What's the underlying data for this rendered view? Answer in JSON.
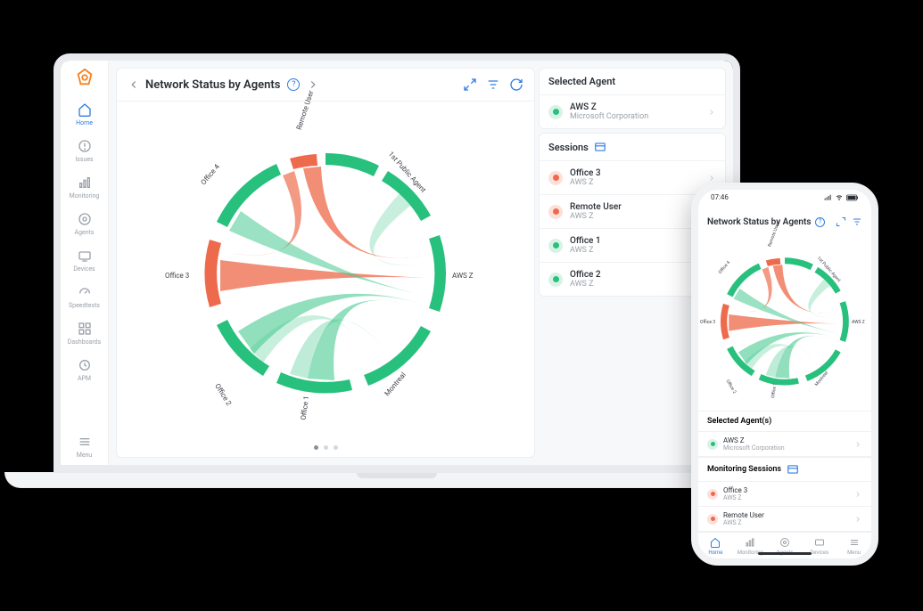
{
  "sidebar": {
    "items": [
      {
        "label": "Home",
        "icon": "home-icon",
        "active": true
      },
      {
        "label": "Issues",
        "icon": "issues-icon"
      },
      {
        "label": "Monitoring",
        "icon": "monitoring-icon"
      },
      {
        "label": "Agents",
        "icon": "agents-icon"
      },
      {
        "label": "Devices",
        "icon": "devices-icon"
      },
      {
        "label": "Speedtests",
        "icon": "speedtests-icon"
      },
      {
        "label": "Dashboards",
        "icon": "dashboards-icon"
      },
      {
        "label": "APM",
        "icon": "apm-icon"
      }
    ],
    "menu_label": "Menu"
  },
  "chart": {
    "title": "Network Status by Agents",
    "info_badge": "?",
    "nodes": [
      "Remote User",
      "1st Public Agent",
      "AWS Z",
      "Montreal",
      "Office 1",
      "Office 2",
      "Office 3",
      "Office 4"
    ]
  },
  "sidepanel": {
    "selected_header": "Selected Agent",
    "selected": {
      "name": "AWS Z",
      "sub": "Microsoft Corporation",
      "status": "green"
    },
    "sessions_header": "Sessions",
    "sessions": [
      {
        "name": "Office 3",
        "sub": "AWS Z",
        "status": "red"
      },
      {
        "name": "Remote User",
        "sub": "AWS Z",
        "status": "red"
      },
      {
        "name": "Office 1",
        "sub": "AWS Z",
        "status": "green"
      },
      {
        "name": "Office 2",
        "sub": "AWS Z",
        "status": "green"
      }
    ]
  },
  "phone": {
    "time": "07:46",
    "title": "Network Status by Agents",
    "selected_header": "Selected Agent(s)",
    "selected": {
      "name": "AWS Z",
      "sub": "Microsoft Corporation",
      "status": "green"
    },
    "sessions_header": "Monitoring Sessions",
    "sessions": [
      {
        "name": "Office 3",
        "sub": "AWS Z",
        "status": "red"
      },
      {
        "name": "Remote User",
        "sub": "AWS Z",
        "status": "red"
      }
    ],
    "tabs": [
      {
        "label": "Home",
        "active": true
      },
      {
        "label": "Monitoring"
      },
      {
        "label": "Agents"
      },
      {
        "label": "Devices"
      },
      {
        "label": "Menu"
      }
    ]
  },
  "chart_data": {
    "type": "chord",
    "title": "Network Status by Agents",
    "nodes": [
      "Remote User",
      "1st Public Agent",
      "AWS Z",
      "Montreal",
      "Office 1",
      "Office 2",
      "Office 3",
      "Office 4"
    ],
    "links": [
      {
        "source": "Remote User",
        "target": "AWS Z",
        "status": "bad",
        "color": "#ee6a4c"
      },
      {
        "source": "Remote User",
        "target": "Office 3",
        "status": "bad",
        "color": "#ee6a4c"
      },
      {
        "source": "Office 3",
        "target": "AWS Z",
        "status": "bad",
        "color": "#ee6a4c"
      },
      {
        "source": "Office 4",
        "target": "AWS Z",
        "status": "good",
        "color": "#28c07d"
      },
      {
        "source": "Office 2",
        "target": "AWS Z",
        "status": "good",
        "color": "#28c07d"
      },
      {
        "source": "Office 1",
        "target": "AWS Z",
        "status": "good",
        "color": "#28c07d"
      },
      {
        "source": "Office 1",
        "target": "Montreal",
        "status": "good",
        "color": "#28c07d"
      },
      {
        "source": "Office 2",
        "target": "Montreal",
        "status": "good",
        "color": "#28c07d"
      },
      {
        "source": "1st Public Agent",
        "target": "AWS Z",
        "status": "good",
        "color": "#28c07d"
      }
    ],
    "status_colors": {
      "good": "#28c07d",
      "bad": "#ee6a4c"
    }
  }
}
